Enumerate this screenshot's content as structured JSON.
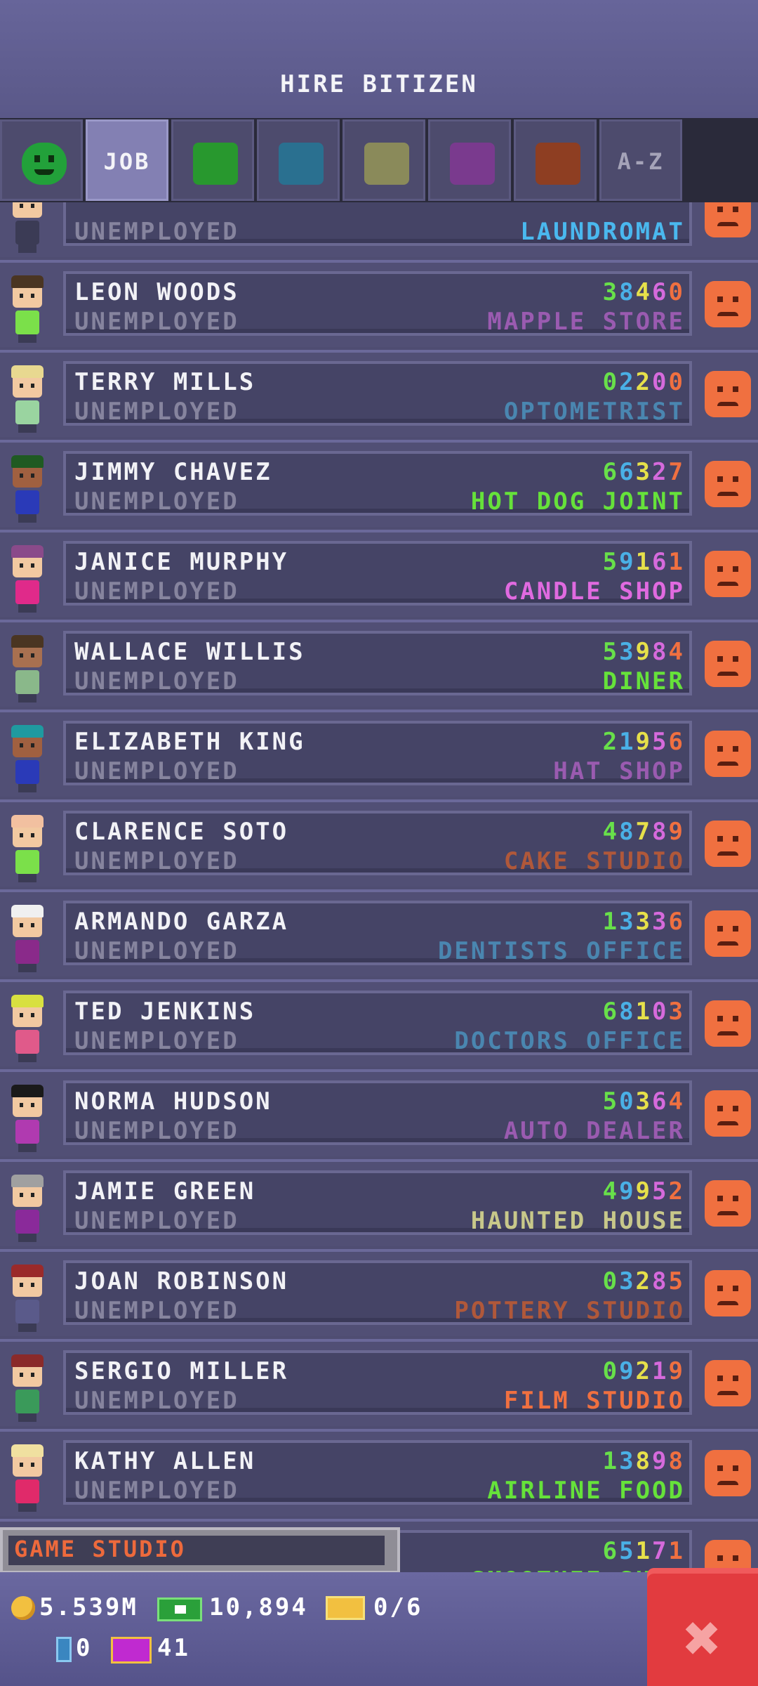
{
  "header": {
    "title": "HIRE BITIZEN"
  },
  "tabs": [
    {
      "kind": "mood",
      "icon": "smiley-icon",
      "color": "#22a13a"
    },
    {
      "kind": "text",
      "label": "JOB",
      "active": true
    },
    {
      "kind": "color",
      "color": "#28982e",
      "icon": "food-category-icon"
    },
    {
      "kind": "color",
      "color": "#2a7090",
      "icon": "service-category-icon"
    },
    {
      "kind": "color",
      "color": "#8a8a5a",
      "icon": "recreation-category-icon"
    },
    {
      "kind": "color",
      "color": "#7a3a8e",
      "icon": "retail-category-icon"
    },
    {
      "kind": "color",
      "color": "#8e3e22",
      "icon": "creative-category-icon"
    },
    {
      "kind": "text",
      "label": "A-Z"
    }
  ],
  "digit_colors": [
    "#68e04a",
    "#4ab0e6",
    "#e6e04a",
    "#d66adc",
    "#f07040"
  ],
  "rows": [
    {
      "name": "",
      "status": "UNEMPLOYED",
      "code": "",
      "job": "LAUNDROMAT",
      "job_color": "#4ab8ee",
      "hair": "#4a3522",
      "shirt": "#3b3b55",
      "skin": "#f2c9a1"
    },
    {
      "name": "LEON WOODS",
      "status": "UNEMPLOYED",
      "code": "38460",
      "job": "MAPPLE STORE",
      "job_color": "#9a5bb0",
      "hair": "#4a3522",
      "shirt": "#7be04a",
      "skin": "#f2c9a1"
    },
    {
      "name": "TERRY MILLS",
      "status": "UNEMPLOYED",
      "code": "02200",
      "job": "OPTOMETRIST",
      "job_color": "#4a86b0",
      "hair": "#e8d890",
      "shirt": "#9ad4a0",
      "skin": "#f2c9a1"
    },
    {
      "name": "JIMMY CHAVEZ",
      "status": "UNEMPLOYED",
      "code": "66327",
      "job": "HOT DOG JOINT",
      "job_color": "#66e23a",
      "hair": "#1f5a22",
      "shirt": "#2a3ab8",
      "skin": "#a06040"
    },
    {
      "name": "JANICE MURPHY",
      "status": "UNEMPLOYED",
      "code": "59161",
      "job": "CANDLE SHOP",
      "job_color": "#e06ae0",
      "hair": "#8a4a8a",
      "shirt": "#e02a8a",
      "skin": "#f2c9a1"
    },
    {
      "name": "WALLACE WILLIS",
      "status": "UNEMPLOYED",
      "code": "53984",
      "job": "DINER",
      "job_color": "#66e23a",
      "hair": "#4a3522",
      "shirt": "#8ab88a",
      "skin": "#a87050"
    },
    {
      "name": "ELIZABETH KING",
      "status": "UNEMPLOYED",
      "code": "21956",
      "job": "HAT SHOP",
      "job_color": "#9a5bb0",
      "hair": "#1f9aa0",
      "shirt": "#2a3ab8",
      "skin": "#a06040"
    },
    {
      "name": "CLARENCE SOTO",
      "status": "UNEMPLOYED",
      "code": "48789",
      "job": "CAKE STUDIO",
      "job_color": "#b0583a",
      "hair": "#f2c0a0",
      "shirt": "#7be04a",
      "skin": "#f2c9a1"
    },
    {
      "name": "ARMANDO GARZA",
      "status": "UNEMPLOYED",
      "code": "13336",
      "job": "DENTISTS OFFICE",
      "job_color": "#4a86b0",
      "hair": "#f0f0f0",
      "shirt": "#8a2a8a",
      "skin": "#f2c9a1"
    },
    {
      "name": "TED JENKINS",
      "status": "UNEMPLOYED",
      "code": "68103",
      "job": "DOCTORS OFFICE",
      "job_color": "#4a86b0",
      "hair": "#d8e040",
      "shirt": "#e05a8a",
      "skin": "#f2c9a1"
    },
    {
      "name": "NORMA HUDSON",
      "status": "UNEMPLOYED",
      "code": "50364",
      "job": "AUTO DEALER",
      "job_color": "#9a5bb0",
      "hair": "#1a1a1a",
      "shirt": "#b03ab0",
      "skin": "#f2c9a1"
    },
    {
      "name": "JAMIE GREEN",
      "status": "UNEMPLOYED",
      "code": "49952",
      "job": "HAUNTED HOUSE",
      "job_color": "#c8c88a",
      "hair": "#a0a0a0",
      "shirt": "#8a2a9a",
      "skin": "#f2c9a1"
    },
    {
      "name": "JOAN ROBINSON",
      "status": "UNEMPLOYED",
      "code": "03285",
      "job": "POTTERY STUDIO",
      "job_color": "#b0583a",
      "hair": "#9a2a2a",
      "shirt": "#5a5a8a",
      "skin": "#f2c9a1"
    },
    {
      "name": "SERGIO MILLER",
      "status": "UNEMPLOYED",
      "code": "09219",
      "job": "FILM STUDIO",
      "job_color": "#f07040",
      "hair": "#8a2a2a",
      "shirt": "#3a9a5a",
      "skin": "#f2c9a1"
    },
    {
      "name": "KATHY ALLEN",
      "status": "UNEMPLOYED",
      "code": "13898",
      "job": "AIRLINE FOOD",
      "job_color": "#66e23a",
      "hair": "#f0e0a0",
      "shirt": "#e02a6a",
      "skin": "#f2c9a1"
    },
    {
      "name": "",
      "status": "",
      "code": "65171",
      "job": "SMOOTHIE SHOP",
      "job_color": "#66e23a",
      "hair": "#4a3522",
      "shirt": "#3b3b55",
      "skin": "#f2c9a1"
    }
  ],
  "banner": {
    "text": "GAME STUDIO"
  },
  "footer": {
    "coins": "5.539M",
    "bux": "10,894",
    "tickets": "0/6",
    "elevator": "0",
    "vip": "41",
    "coin_icon": "coin-icon",
    "bux_icon": "bux-icon",
    "ticket_icon": "golden-ticket-icon",
    "elevator_icon": "elevator-icon",
    "vip_icon": "vip-icon"
  },
  "close": {
    "icon": "close-icon",
    "label": "✖"
  }
}
